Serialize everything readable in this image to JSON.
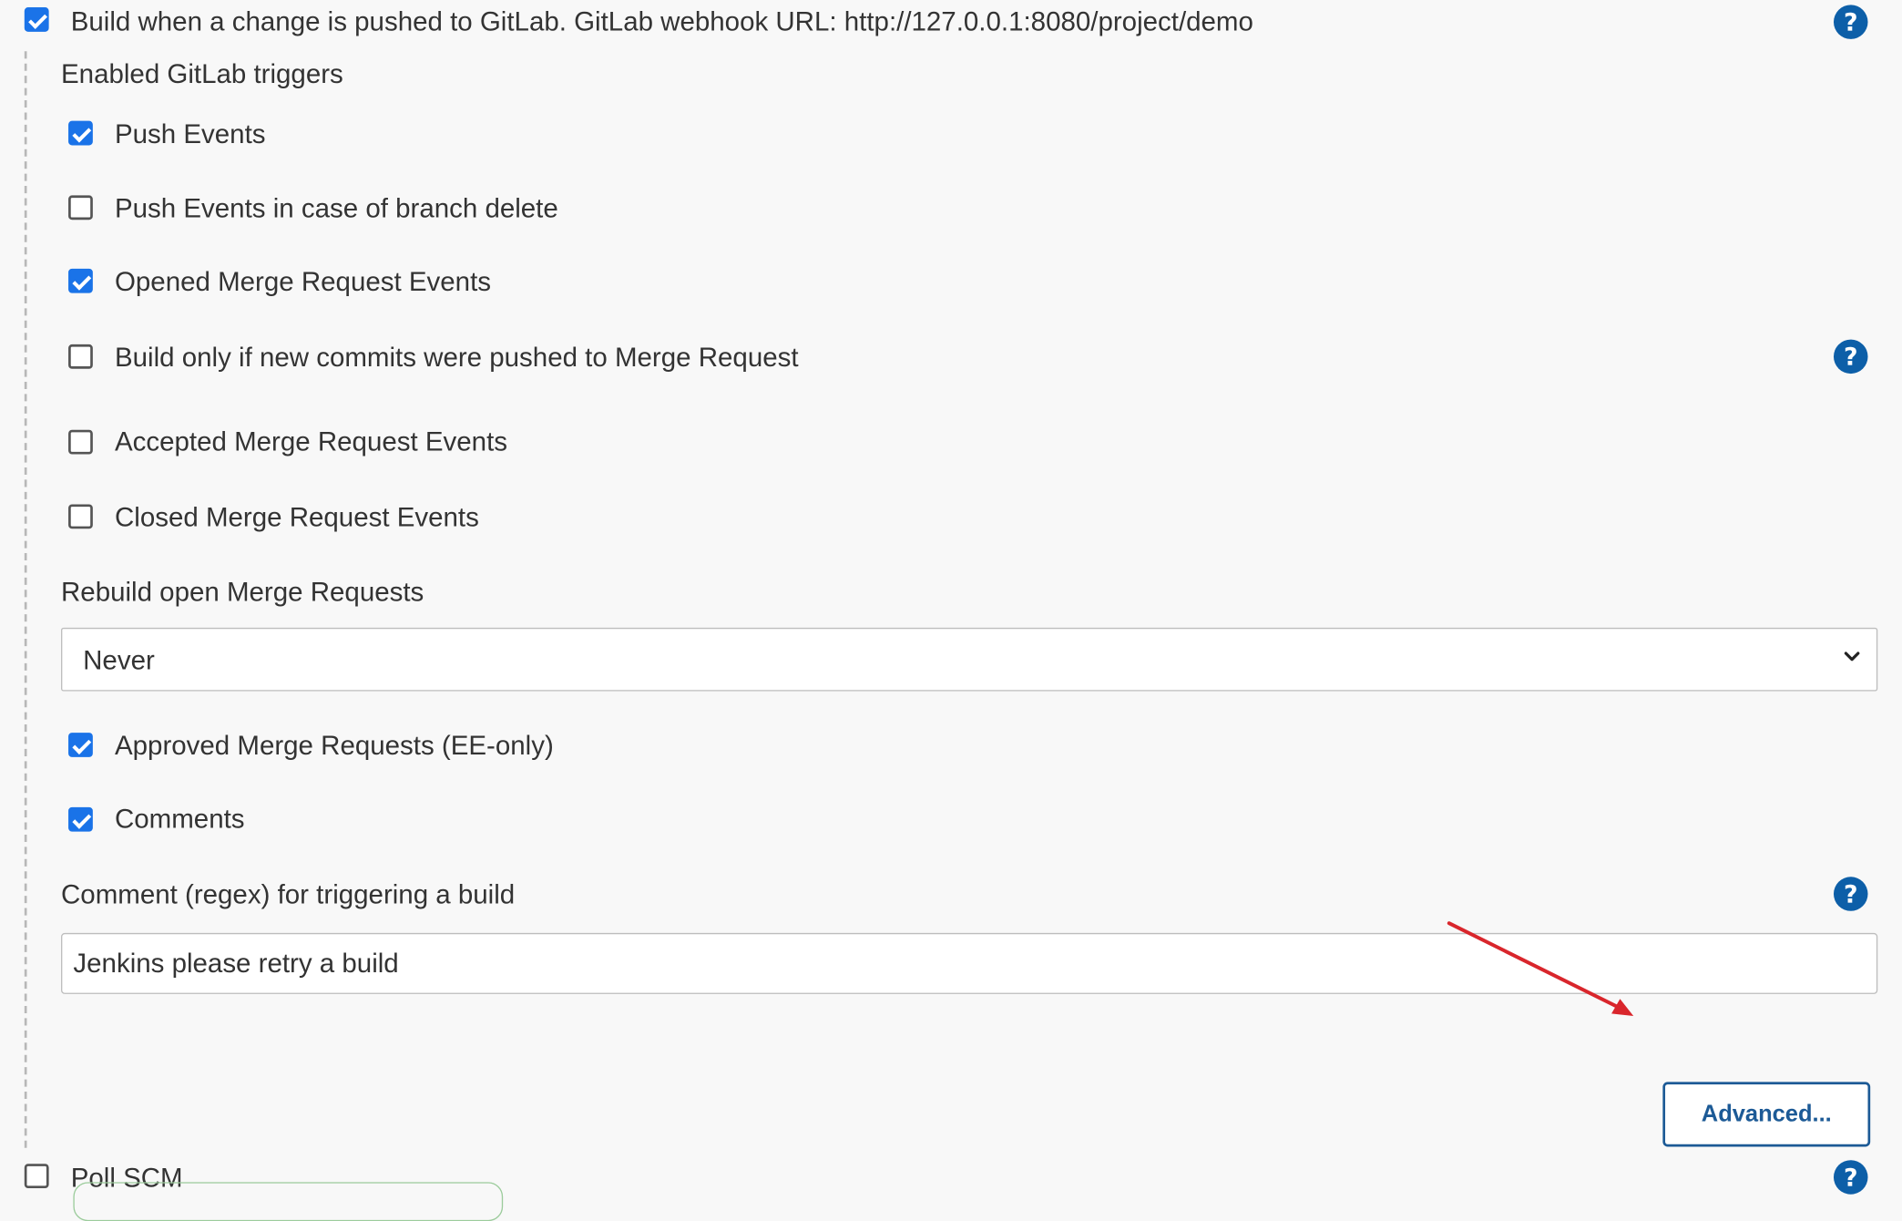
{
  "trigger": {
    "build_on_push_label": "Build when a change is pushed to GitLab. GitLab webhook URL: http://127.0.0.1:8080/project/demo",
    "build_on_push_checked": true
  },
  "gitlab_triggers": {
    "heading": "Enabled GitLab triggers",
    "items": [
      {
        "label": "Push Events",
        "checked": true
      },
      {
        "label": "Push Events in case of branch delete",
        "checked": false
      },
      {
        "label": "Opened Merge Request Events",
        "checked": true
      },
      {
        "label": "Build only if new commits were pushed to Merge Request",
        "checked": false
      },
      {
        "label": "Accepted Merge Request Events",
        "checked": false
      },
      {
        "label": "Closed Merge Request Events",
        "checked": false
      }
    ]
  },
  "rebuild": {
    "label": "Rebuild open Merge Requests",
    "selected": "Never"
  },
  "extra_triggers": {
    "items": [
      {
        "label": "Approved Merge Requests (EE-only)",
        "checked": true
      },
      {
        "label": "Comments",
        "checked": true
      }
    ]
  },
  "comment_regex": {
    "label": "Comment (regex) for triggering a build",
    "value": "Jenkins please retry a build"
  },
  "advanced_button": {
    "label": "Advanced..."
  },
  "poll_scm": {
    "label": "Poll SCM",
    "checked": false
  },
  "help": {
    "glyph": "?"
  },
  "colors": {
    "accent": "#1a73e8",
    "help_icon": "#0d5fa8",
    "button_border": "#1c5a96",
    "annotation_arrow": "#d9262c"
  }
}
